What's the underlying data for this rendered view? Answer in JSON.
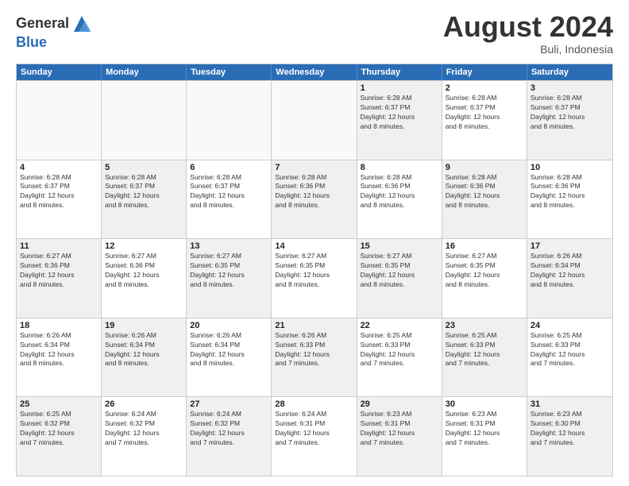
{
  "logo": {
    "general": "General",
    "blue": "Blue"
  },
  "title": "August 2024",
  "subtitle": "Buli, Indonesia",
  "days": [
    "Sunday",
    "Monday",
    "Tuesday",
    "Wednesday",
    "Thursday",
    "Friday",
    "Saturday"
  ],
  "weeks": [
    [
      {
        "day": "",
        "info": "",
        "empty": true
      },
      {
        "day": "",
        "info": "",
        "empty": true
      },
      {
        "day": "",
        "info": "",
        "empty": true
      },
      {
        "day": "",
        "info": "",
        "empty": true
      },
      {
        "day": "1",
        "info": "Sunrise: 6:28 AM\nSunset: 6:37 PM\nDaylight: 12 hours\nand 8 minutes.",
        "shaded": true
      },
      {
        "day": "2",
        "info": "Sunrise: 6:28 AM\nSunset: 6:37 PM\nDaylight: 12 hours\nand 8 minutes.",
        "shaded": false
      },
      {
        "day": "3",
        "info": "Sunrise: 6:28 AM\nSunset: 6:37 PM\nDaylight: 12 hours\nand 8 minutes.",
        "shaded": true
      }
    ],
    [
      {
        "day": "4",
        "info": "Sunrise: 6:28 AM\nSunset: 6:37 PM\nDaylight: 12 hours\nand 8 minutes.",
        "shaded": false
      },
      {
        "day": "5",
        "info": "Sunrise: 6:28 AM\nSunset: 6:37 PM\nDaylight: 12 hours\nand 8 minutes.",
        "shaded": true
      },
      {
        "day": "6",
        "info": "Sunrise: 6:28 AM\nSunset: 6:37 PM\nDaylight: 12 hours\nand 8 minutes.",
        "shaded": false
      },
      {
        "day": "7",
        "info": "Sunrise: 6:28 AM\nSunset: 6:36 PM\nDaylight: 12 hours\nand 8 minutes.",
        "shaded": true
      },
      {
        "day": "8",
        "info": "Sunrise: 6:28 AM\nSunset: 6:36 PM\nDaylight: 12 hours\nand 8 minutes.",
        "shaded": false
      },
      {
        "day": "9",
        "info": "Sunrise: 6:28 AM\nSunset: 6:36 PM\nDaylight: 12 hours\nand 8 minutes.",
        "shaded": true
      },
      {
        "day": "10",
        "info": "Sunrise: 6:28 AM\nSunset: 6:36 PM\nDaylight: 12 hours\nand 8 minutes.",
        "shaded": false
      }
    ],
    [
      {
        "day": "11",
        "info": "Sunrise: 6:27 AM\nSunset: 6:36 PM\nDaylight: 12 hours\nand 8 minutes.",
        "shaded": true
      },
      {
        "day": "12",
        "info": "Sunrise: 6:27 AM\nSunset: 6:36 PM\nDaylight: 12 hours\nand 8 minutes.",
        "shaded": false
      },
      {
        "day": "13",
        "info": "Sunrise: 6:27 AM\nSunset: 6:35 PM\nDaylight: 12 hours\nand 8 minutes.",
        "shaded": true
      },
      {
        "day": "14",
        "info": "Sunrise: 6:27 AM\nSunset: 6:35 PM\nDaylight: 12 hours\nand 8 minutes.",
        "shaded": false
      },
      {
        "day": "15",
        "info": "Sunrise: 6:27 AM\nSunset: 6:35 PM\nDaylight: 12 hours\nand 8 minutes.",
        "shaded": true
      },
      {
        "day": "16",
        "info": "Sunrise: 6:27 AM\nSunset: 6:35 PM\nDaylight: 12 hours\nand 8 minutes.",
        "shaded": false
      },
      {
        "day": "17",
        "info": "Sunrise: 6:26 AM\nSunset: 6:34 PM\nDaylight: 12 hours\nand 8 minutes.",
        "shaded": true
      }
    ],
    [
      {
        "day": "18",
        "info": "Sunrise: 6:26 AM\nSunset: 6:34 PM\nDaylight: 12 hours\nand 8 minutes.",
        "shaded": false
      },
      {
        "day": "19",
        "info": "Sunrise: 6:26 AM\nSunset: 6:34 PM\nDaylight: 12 hours\nand 8 minutes.",
        "shaded": true
      },
      {
        "day": "20",
        "info": "Sunrise: 6:26 AM\nSunset: 6:34 PM\nDaylight: 12 hours\nand 8 minutes.",
        "shaded": false
      },
      {
        "day": "21",
        "info": "Sunrise: 6:26 AM\nSunset: 6:33 PM\nDaylight: 12 hours\nand 7 minutes.",
        "shaded": true
      },
      {
        "day": "22",
        "info": "Sunrise: 6:25 AM\nSunset: 6:33 PM\nDaylight: 12 hours\nand 7 minutes.",
        "shaded": false
      },
      {
        "day": "23",
        "info": "Sunrise: 6:25 AM\nSunset: 6:33 PM\nDaylight: 12 hours\nand 7 minutes.",
        "shaded": true
      },
      {
        "day": "24",
        "info": "Sunrise: 6:25 AM\nSunset: 6:33 PM\nDaylight: 12 hours\nand 7 minutes.",
        "shaded": false
      }
    ],
    [
      {
        "day": "25",
        "info": "Sunrise: 6:25 AM\nSunset: 6:32 PM\nDaylight: 12 hours\nand 7 minutes.",
        "shaded": true
      },
      {
        "day": "26",
        "info": "Sunrise: 6:24 AM\nSunset: 6:32 PM\nDaylight: 12 hours\nand 7 minutes.",
        "shaded": false
      },
      {
        "day": "27",
        "info": "Sunrise: 6:24 AM\nSunset: 6:32 PM\nDaylight: 12 hours\nand 7 minutes.",
        "shaded": true
      },
      {
        "day": "28",
        "info": "Sunrise: 6:24 AM\nSunset: 6:31 PM\nDaylight: 12 hours\nand 7 minutes.",
        "shaded": false
      },
      {
        "day": "29",
        "info": "Sunrise: 6:23 AM\nSunset: 6:31 PM\nDaylight: 12 hours\nand 7 minutes.",
        "shaded": true
      },
      {
        "day": "30",
        "info": "Sunrise: 6:23 AM\nSunset: 6:31 PM\nDaylight: 12 hours\nand 7 minutes.",
        "shaded": false
      },
      {
        "day": "31",
        "info": "Sunrise: 6:23 AM\nSunset: 6:30 PM\nDaylight: 12 hours\nand 7 minutes.",
        "shaded": true
      }
    ]
  ]
}
